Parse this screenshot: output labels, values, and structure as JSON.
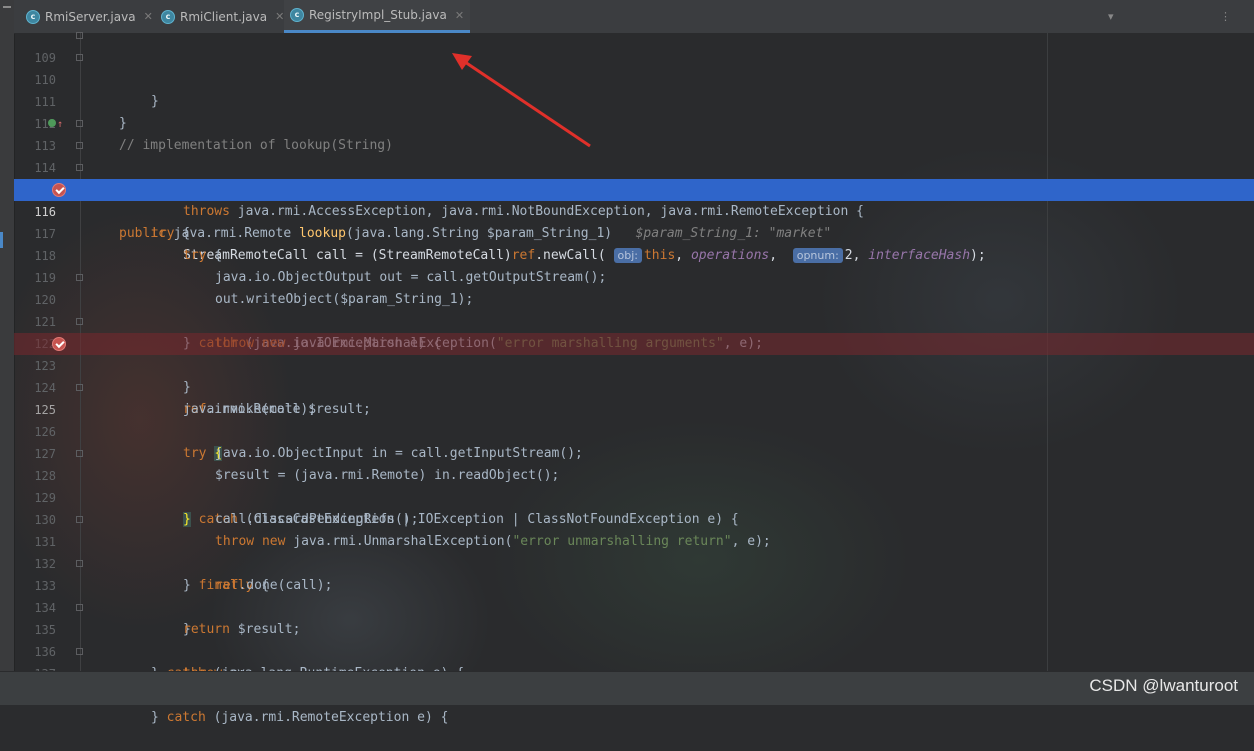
{
  "tabs": [
    {
      "label": "RmiServer.java",
      "icon": "java-class-icon",
      "active": false
    },
    {
      "label": "RmiClient.java",
      "icon": "java-class-icon",
      "active": false
    },
    {
      "label": "RegistryImpl_Stub.java",
      "icon": "java-class-icon",
      "active": true
    }
  ],
  "editor": {
    "current_line": 125,
    "execution_line": 116,
    "breakpoint_lines": [
      116,
      123
    ],
    "lines": [
      {
        "n": "109",
        "text": "}"
      },
      {
        "n": "110",
        "text": "}"
      },
      {
        "n": "111",
        "text": ""
      },
      {
        "n": "112",
        "text": "// implementation of lookup(String)"
      },
      {
        "n": "113",
        "text": "public java.rmi.Remote lookup(java.lang.String $param_String_1)",
        "inline": "$param_String_1: \"market\""
      },
      {
        "n": "114",
        "text": "throws java.rmi.AccessException, java.rmi.NotBoundException, java.rmi.RemoteException {"
      },
      {
        "n": "115",
        "text": "try {"
      },
      {
        "n": "116",
        "text": "StreamRemoteCall call = (StreamRemoteCall)ref.newCall( obj: this, operations,  opnum: 2, interfaceHash);",
        "hint_obj": "obj:",
        "hint_opnum": "opnum:"
      },
      {
        "n": "117",
        "text": "try {"
      },
      {
        "n": "118",
        "text": "java.io.ObjectOutput out = call.getOutputStream();"
      },
      {
        "n": "119",
        "text": "out.writeObject($param_String_1);"
      },
      {
        "n": "120",
        "text": "} catch (java.io.IOException e) {"
      },
      {
        "n": "121",
        "text": "throw new java.rmi.MarshalException(\"error marshalling arguments\", e);"
      },
      {
        "n": "122",
        "text": "}"
      },
      {
        "n": "123",
        "text": "ref.invoke(call);"
      },
      {
        "n": "124",
        "text": "java.rmi.Remote $result;"
      },
      {
        "n": "125",
        "text": "try {"
      },
      {
        "n": "126",
        "text": "java.io.ObjectInput in = call.getInputStream();"
      },
      {
        "n": "127",
        "text": "$result = (java.rmi.Remote) in.readObject();"
      },
      {
        "n": "128",
        "text": "} catch (ClassCastException | IOException | ClassNotFoundException e) {"
      },
      {
        "n": "129",
        "text": "call.discardPendingRefs();"
      },
      {
        "n": "130",
        "text": "throw new java.rmi.UnmarshalException(\"error unmarshalling return\", e);"
      },
      {
        "n": "131",
        "text": "} finally {"
      },
      {
        "n": "132",
        "text": "ref.done(call);"
      },
      {
        "n": "133",
        "text": "}"
      },
      {
        "n": "134",
        "text": "return $result;"
      },
      {
        "n": "135",
        "text": "} catch (java.lang.RuntimeException e) {"
      },
      {
        "n": "136",
        "text": "throw e;"
      },
      {
        "n": "137",
        "text": "} catch (java.rmi.RemoteException e) {"
      }
    ]
  },
  "watermark": "CSDN @lwanturoot",
  "colors": {
    "accent": "#4a88c7",
    "exec_highlight": "#2f65ca",
    "breakpoint": "#c75450",
    "annotation_arrow": "#e0302a"
  }
}
